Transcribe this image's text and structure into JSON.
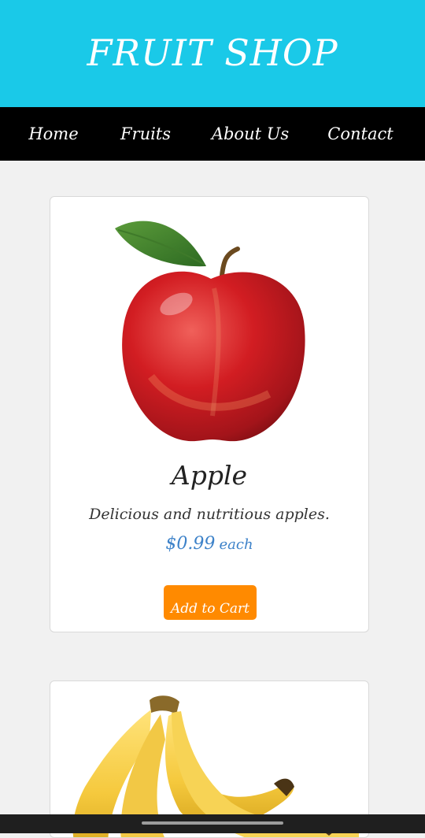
{
  "header": {
    "title": "FRUIT SHOP",
    "background_color": "#1ac9e8"
  },
  "nav": {
    "items": [
      {
        "label": "Home"
      },
      {
        "label": "Fruits"
      },
      {
        "label": "About Us"
      },
      {
        "label": "Contact"
      }
    ]
  },
  "products": [
    {
      "name": "Apple",
      "description": "Delicious and nutritious apples.",
      "price": "$0.99",
      "price_unit": "each",
      "button_label": "Add to Cart",
      "image_icon": "apple-image"
    },
    {
      "image_icon": "banana-image"
    }
  ],
  "colors": {
    "accent": "#ff8a00",
    "price": "#3d82c9",
    "nav_background": "#000000"
  }
}
